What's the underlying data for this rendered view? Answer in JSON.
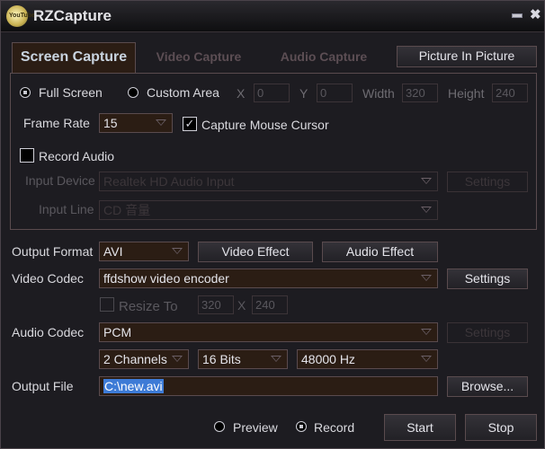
{
  "window": {
    "title": "RZCapture",
    "logo_text": "YouTube"
  },
  "tabs": [
    {
      "label": "Screen Capture",
      "active": true
    },
    {
      "label": "Video Capture",
      "active": false
    },
    {
      "label": "Audio Capture",
      "active": false
    }
  ],
  "pip_button": "Picture In Picture",
  "capture": {
    "full_screen": "Full Screen",
    "custom_area": "Custom Area",
    "mode": "Full Screen",
    "x_label": "X",
    "x_value": "0",
    "y_label": "Y",
    "y_value": "0",
    "width_label": "Width",
    "width_value": "320",
    "height_label": "Height",
    "height_value": "240",
    "frame_rate_label": "Frame Rate",
    "frame_rate_value": "15",
    "capture_cursor_label": "Capture Mouse Cursor",
    "capture_cursor_checked": true,
    "record_audio_label": "Record Audio",
    "record_audio_checked": false,
    "input_device_label": "Input Device",
    "input_device_value": "Realtek HD Audio Input",
    "input_line_label": "Input Line",
    "input_line_value": "CD 音量",
    "settings_label": "Settings",
    "check_glyph": "✓"
  },
  "output": {
    "format_label": "Output Format",
    "format_value": "AVI",
    "video_effect": "Video Effect",
    "audio_effect": "Audio Effect",
    "video_codec_label": "Video Codec",
    "video_codec_value": "ffdshow video encoder",
    "video_settings": "Settings",
    "resize_label": "Resize To",
    "resize_w": "320",
    "resize_x": "X",
    "resize_h": "240",
    "audio_codec_label": "Audio Codec",
    "audio_codec_value": "PCM",
    "audio_settings": "Settings",
    "channels": "2 Channels",
    "bits": "16 Bits",
    "rate": "48000 Hz",
    "file_label": "Output File",
    "file_value": "C:\\new.avi",
    "browse": "Browse..."
  },
  "footer": {
    "preview": "Preview",
    "record": "Record",
    "mode": "Record",
    "start": "Start",
    "stop": "Stop"
  }
}
